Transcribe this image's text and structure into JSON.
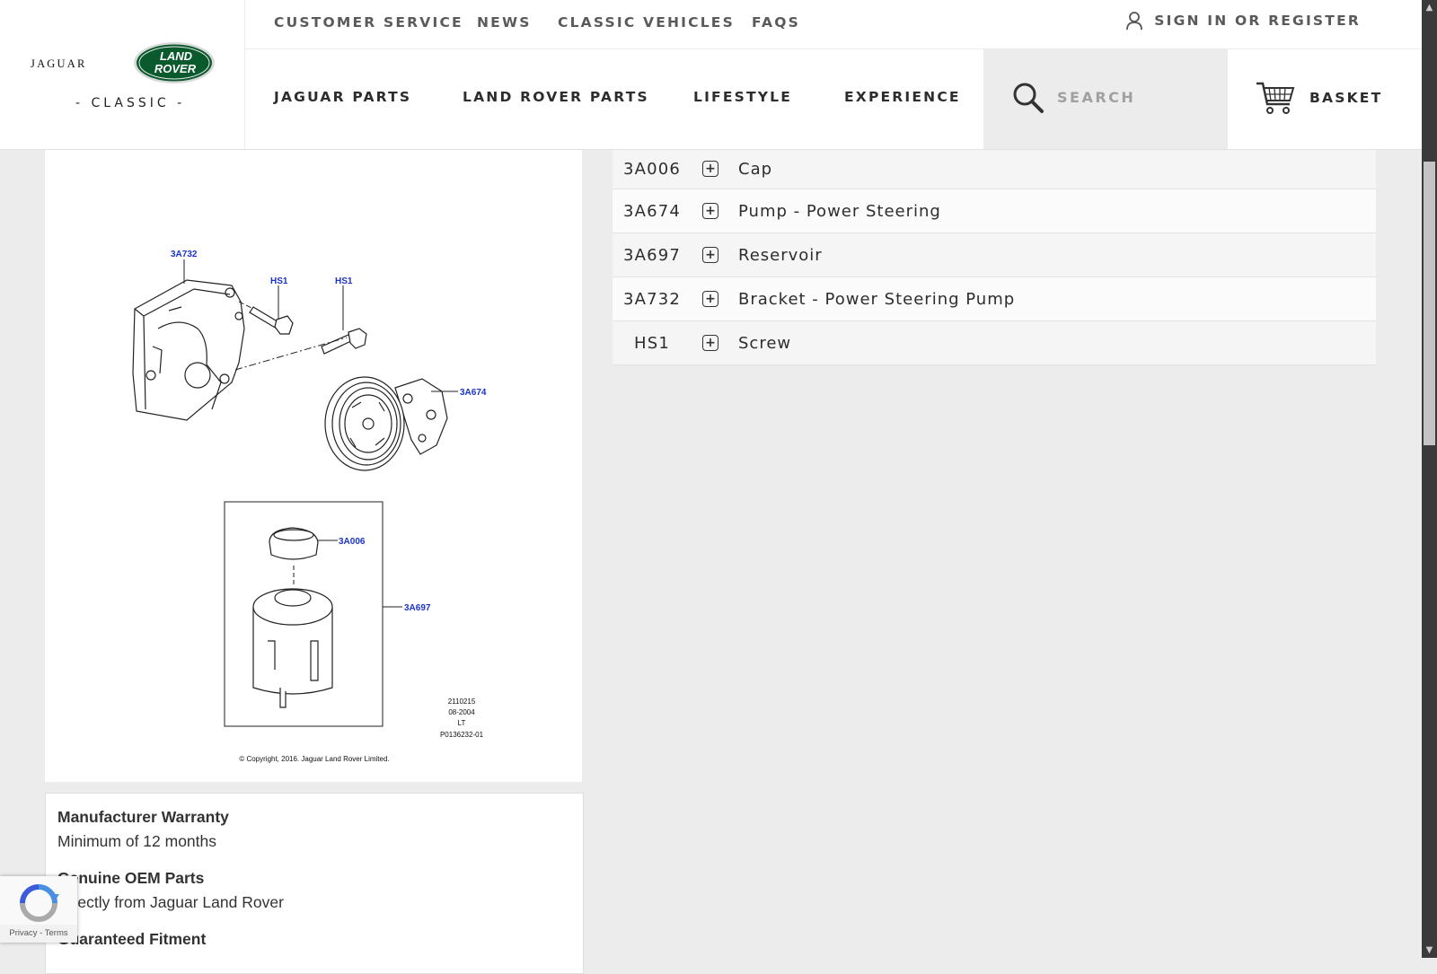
{
  "brand": {
    "jaguar": "JAGUAR",
    "land_rover_line1": "LAND",
    "land_rover_line2": "ROVER",
    "classic": "- CLASSIC -"
  },
  "top_nav": {
    "items": [
      "CUSTOMER SERVICE",
      "NEWS",
      "CLASSIC VEHICLES",
      "FAQS"
    ],
    "sign_in": "SIGN IN OR REGISTER"
  },
  "main_nav": {
    "items": [
      "JAGUAR PARTS",
      "LAND ROVER PARTS",
      "LIFESTYLE",
      "EXPERIENCE"
    ],
    "search_placeholder": "SEARCH",
    "basket": "BASKET"
  },
  "diagram": {
    "callouts": {
      "bracket": "3A732",
      "screw_left": "HS1",
      "screw_right": "HS1",
      "pump": "3A674",
      "cap": "3A006",
      "reservoir": "3A697"
    },
    "ref_lines": [
      "2110215",
      "08-2004",
      "LT",
      "P0136232-01"
    ],
    "copyright": "© Copyright, 2016. Jaguar Land Rover Limited."
  },
  "parts": [
    {
      "code": "3A006",
      "name": "Cap"
    },
    {
      "code": "3A674",
      "name": "Pump - Power Steering"
    },
    {
      "code": "3A697",
      "name": "Reservoir"
    },
    {
      "code": "3A732",
      "name": "Bracket - Power Steering Pump"
    },
    {
      "code": "HS1",
      "name": "Screw"
    }
  ],
  "info": {
    "warranty_title": "Manufacturer Warranty",
    "warranty_text": "Minimum of 12 months",
    "oem_title": "Genuine OEM Parts",
    "oem_text": "Directly from Jaguar Land Rover",
    "fitment_title": "Guaranteed Fitment"
  },
  "recaptcha": {
    "links": "Privacy - Terms"
  },
  "colors": {
    "land_rover_green": "#0b5a2e",
    "callout_blue": "#1a33cc"
  }
}
